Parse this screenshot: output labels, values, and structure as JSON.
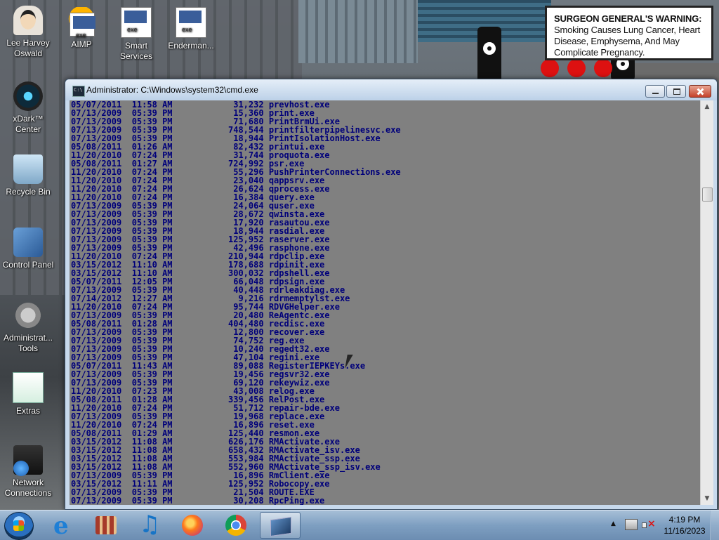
{
  "desktop": {
    "icons": [
      {
        "label": "Lee Harvey\nOswald",
        "icon": "portrait-icon"
      },
      {
        "label": "AIMP",
        "icon": "aimp-icon"
      },
      {
        "label": "Smart\nServices",
        "icon": "services-icon"
      },
      {
        "label": "Enderman...",
        "icon": "program-icon"
      },
      {
        "label": "xDark™\nCenter",
        "icon": "xdark-icon"
      },
      {
        "label": "Recycle Bin",
        "icon": "recycle-bin-icon"
      },
      {
        "label": "Control Panel",
        "icon": "control-panel-icon"
      },
      {
        "label": "Administrat...\nTools",
        "icon": "admin-tools-icon"
      },
      {
        "label": "Extras",
        "icon": "extras-icon"
      },
      {
        "label": "Network\nConnections",
        "icon": "network-icon"
      }
    ],
    "warning": {
      "bold": "SURGEON GENERAL'S WARNING:",
      "text": " Smoking Causes Lung Cancer, Heart Disease, Emphysema, And May Complicate Pregnancy."
    }
  },
  "window": {
    "title": "Administrator: C:\\Windows\\system32\\cmd.exe",
    "lines": [
      {
        "date": "05/07/2011",
        "time": "11:58",
        "ampm": "AM",
        "size": "31,232",
        "name": "prevhost.exe"
      },
      {
        "date": "07/13/2009",
        "time": "05:39",
        "ampm": "PM",
        "size": "15,360",
        "name": "print.exe"
      },
      {
        "date": "07/13/2009",
        "time": "05:39",
        "ampm": "PM",
        "size": "71,680",
        "name": "PrintBrmUi.exe"
      },
      {
        "date": "07/13/2009",
        "time": "05:39",
        "ampm": "PM",
        "size": "748,544",
        "name": "printfilterpipelinesvc.exe"
      },
      {
        "date": "07/13/2009",
        "time": "05:39",
        "ampm": "PM",
        "size": "18,944",
        "name": "PrintIsolationHost.exe"
      },
      {
        "date": "05/08/2011",
        "time": "01:26",
        "ampm": "AM",
        "size": "82,432",
        "name": "printui.exe"
      },
      {
        "date": "11/20/2010",
        "time": "07:24",
        "ampm": "PM",
        "size": "31,744",
        "name": "proquota.exe"
      },
      {
        "date": "05/08/2011",
        "time": "01:27",
        "ampm": "AM",
        "size": "724,992",
        "name": "psr.exe"
      },
      {
        "date": "11/20/2010",
        "time": "07:24",
        "ampm": "PM",
        "size": "55,296",
        "name": "PushPrinterConnections.exe"
      },
      {
        "date": "11/20/2010",
        "time": "07:24",
        "ampm": "PM",
        "size": "23,040",
        "name": "qappsrv.exe"
      },
      {
        "date": "11/20/2010",
        "time": "07:24",
        "ampm": "PM",
        "size": "26,624",
        "name": "qprocess.exe"
      },
      {
        "date": "11/20/2010",
        "time": "07:24",
        "ampm": "PM",
        "size": "16,384",
        "name": "query.exe"
      },
      {
        "date": "07/13/2009",
        "time": "05:39",
        "ampm": "PM",
        "size": "24,064",
        "name": "quser.exe"
      },
      {
        "date": "07/13/2009",
        "time": "05:39",
        "ampm": "PM",
        "size": "28,672",
        "name": "qwinsta.exe"
      },
      {
        "date": "07/13/2009",
        "time": "05:39",
        "ampm": "PM",
        "size": "17,920",
        "name": "rasautou.exe"
      },
      {
        "date": "07/13/2009",
        "time": "05:39",
        "ampm": "PM",
        "size": "18,944",
        "name": "rasdial.exe"
      },
      {
        "date": "07/13/2009",
        "time": "05:39",
        "ampm": "PM",
        "size": "125,952",
        "name": "raserver.exe"
      },
      {
        "date": "07/13/2009",
        "time": "05:39",
        "ampm": "PM",
        "size": "42,496",
        "name": "rasphone.exe"
      },
      {
        "date": "11/20/2010",
        "time": "07:24",
        "ampm": "PM",
        "size": "210,944",
        "name": "rdpclip.exe"
      },
      {
        "date": "03/15/2012",
        "time": "11:10",
        "ampm": "AM",
        "size": "178,688",
        "name": "rdpinit.exe"
      },
      {
        "date": "03/15/2012",
        "time": "11:10",
        "ampm": "AM",
        "size": "300,032",
        "name": "rdpshell.exe"
      },
      {
        "date": "05/07/2011",
        "time": "12:05",
        "ampm": "PM",
        "size": "66,048",
        "name": "rdpsign.exe"
      },
      {
        "date": "07/13/2009",
        "time": "05:39",
        "ampm": "PM",
        "size": "40,448",
        "name": "rdrleakdiag.exe"
      },
      {
        "date": "07/14/2012",
        "time": "12:27",
        "ampm": "AM",
        "size": "9,216",
        "name": "rdrmemptylst.exe"
      },
      {
        "date": "11/20/2010",
        "time": "07:24",
        "ampm": "PM",
        "size": "95,744",
        "name": "RDVGHelper.exe"
      },
      {
        "date": "07/13/2009",
        "time": "05:39",
        "ampm": "PM",
        "size": "20,480",
        "name": "ReAgentc.exe"
      },
      {
        "date": "05/08/2011",
        "time": "01:28",
        "ampm": "AM",
        "size": "404,480",
        "name": "recdisc.exe"
      },
      {
        "date": "07/13/2009",
        "time": "05:39",
        "ampm": "PM",
        "size": "12,800",
        "name": "recover.exe"
      },
      {
        "date": "07/13/2009",
        "time": "05:39",
        "ampm": "PM",
        "size": "74,752",
        "name": "reg.exe"
      },
      {
        "date": "07/13/2009",
        "time": "05:39",
        "ampm": "PM",
        "size": "10,240",
        "name": "regedt32.exe"
      },
      {
        "date": "07/13/2009",
        "time": "05:39",
        "ampm": "PM",
        "size": "47,104",
        "name": "regini.exe"
      },
      {
        "date": "05/07/2011",
        "time": "11:43",
        "ampm": "AM",
        "size": "89,088",
        "name": "RegisterIEPKEYs.exe"
      },
      {
        "date": "07/13/2009",
        "time": "05:39",
        "ampm": "PM",
        "size": "19,456",
        "name": "regsvr32.exe"
      },
      {
        "date": "07/13/2009",
        "time": "05:39",
        "ampm": "PM",
        "size": "69,120",
        "name": "rekeywiz.exe"
      },
      {
        "date": "11/20/2010",
        "time": "07:23",
        "ampm": "PM",
        "size": "43,008",
        "name": "relog.exe"
      },
      {
        "date": "05/08/2011",
        "time": "01:28",
        "ampm": "AM",
        "size": "339,456",
        "name": "RelPost.exe"
      },
      {
        "date": "11/20/2010",
        "time": "07:24",
        "ampm": "PM",
        "size": "51,712",
        "name": "repair-bde.exe"
      },
      {
        "date": "07/13/2009",
        "time": "05:39",
        "ampm": "PM",
        "size": "19,968",
        "name": "replace.exe"
      },
      {
        "date": "11/20/2010",
        "time": "07:24",
        "ampm": "PM",
        "size": "16,896",
        "name": "reset.exe"
      },
      {
        "date": "05/08/2011",
        "time": "01:29",
        "ampm": "AM",
        "size": "125,440",
        "name": "resmon.exe"
      },
      {
        "date": "03/15/2012",
        "time": "11:08",
        "ampm": "AM",
        "size": "626,176",
        "name": "RMActivate.exe"
      },
      {
        "date": "03/15/2012",
        "time": "11:08",
        "ampm": "AM",
        "size": "658,432",
        "name": "RMActivate_isv.exe"
      },
      {
        "date": "03/15/2012",
        "time": "11:08",
        "ampm": "AM",
        "size": "553,984",
        "name": "RMActivate_ssp.exe"
      },
      {
        "date": "03/15/2012",
        "time": "11:08",
        "ampm": "AM",
        "size": "552,960",
        "name": "RMActivate_ssp_isv.exe"
      },
      {
        "date": "07/13/2009",
        "time": "05:39",
        "ampm": "PM",
        "size": "16,896",
        "name": "RmClient.exe"
      },
      {
        "date": "03/15/2012",
        "time": "11:11",
        "ampm": "AM",
        "size": "125,952",
        "name": "Robocopy.exe"
      },
      {
        "date": "07/13/2009",
        "time": "05:39",
        "ampm": "PM",
        "size": "21,504",
        "name": "ROUTE.EXE"
      },
      {
        "date": "07/13/2009",
        "time": "05:39",
        "ampm": "PM",
        "size": "30,208",
        "name": "RpcPing.exe"
      }
    ]
  },
  "taskbar": {
    "items": [
      "internet-explorer-icon",
      "windows-app-icon",
      "music-icon",
      "firefox-icon",
      "chrome-icon",
      "cmd-icon"
    ],
    "clock": {
      "time": "4:19 PM",
      "date": "11/16/2023"
    }
  }
}
